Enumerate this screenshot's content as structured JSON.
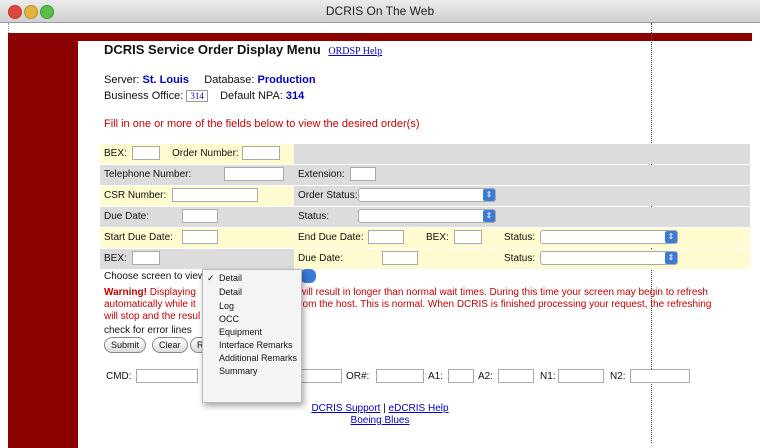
{
  "window": {
    "title": "DCRIS On The Web"
  },
  "header": {
    "title": "DCRIS Service Order Display Menu",
    "help_link": "ORDSP Help"
  },
  "info": {
    "server_label": "Server:",
    "server_value": "St. Louis",
    "database_label": "Database:",
    "database_value": "Production",
    "business_office_label": "Business Office:",
    "business_office_value": "314",
    "default_npa_label": "Default NPA:",
    "default_npa_value": "314"
  },
  "instructions": "Fill in one or more of the fields below to view the desired order(s)",
  "form": {
    "bex1_label": "BEX:",
    "order_number_label": "Order Number:",
    "telephone_label": "Telephone Number:",
    "extension_label": "Extension:",
    "csr_label": "CSR Number:",
    "order_status_label": "Order Status:",
    "due_date_label": "Due Date:",
    "status1_label": "Status:",
    "start_due_label": "Start Due Date:",
    "end_due_label": "End Due Date:",
    "bex2_label": "BEX:",
    "status2_label": "Status:",
    "bex3_label": "BEX:",
    "due_date2_label": "Due Date:",
    "status3_label": "Status:"
  },
  "choose_label": "Choose screen to view",
  "screen_options": [
    "Detail",
    "Detail",
    "Log",
    "OCC",
    "Equipment",
    "Interface Remarks",
    "Additional Remarks",
    "Summary"
  ],
  "selected_screen": "Detail",
  "warning": {
    "bold": "Warning!",
    "line1_a": "Displaying",
    "line1_b": "teria will result in longer than normal wait times. During this time your screen may begin to refresh",
    "line2_a": "automatically while it",
    "line2_b": "ed from the host. This is normal. When DCRIS is finished processing your request, the refreshing",
    "line3": "will stop and the resul"
  },
  "check_label": "check for error lines",
  "buttons": {
    "submit": "Submit",
    "clear": "Clear",
    "partial": "R"
  },
  "cmd": {
    "cmd_label": "CMD:",
    "or_label": "OR#:",
    "a1_label": "A1:",
    "a2_label": "A2:",
    "n1_label": "N1:",
    "n2_label": "N2:"
  },
  "footer": {
    "support": "DCRIS Support",
    "separator": "|",
    "help": "eDCRIS Help",
    "blues": "Boeing Blues"
  }
}
